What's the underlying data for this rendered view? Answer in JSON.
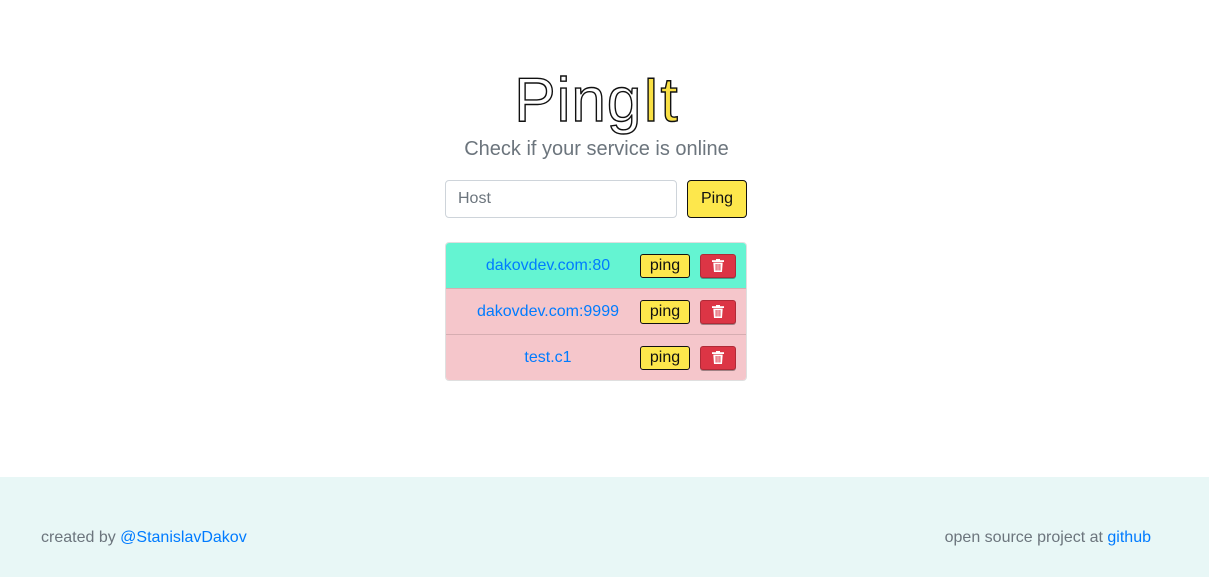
{
  "header": {
    "logo_part1": "Ping",
    "logo_part2": "It",
    "tagline": "Check if your service is online"
  },
  "form": {
    "host_placeholder": "Host",
    "host_value": "",
    "ping_label": "Ping"
  },
  "hosts": [
    {
      "host": "dakovdev.com:80",
      "status": "online",
      "ping_label": "ping",
      "delete_icon": "trash-icon"
    },
    {
      "host": "dakovdev.com:9999",
      "status": "offline",
      "ping_label": "ping",
      "delete_icon": "trash-icon"
    },
    {
      "host": "test.c1",
      "status": "offline",
      "ping_label": "ping",
      "delete_icon": "trash-icon"
    }
  ],
  "footer": {
    "created_prefix": "created by",
    "author_link": "@StanislavDakov",
    "open_source_prefix": "open source project at",
    "github_link": "github"
  },
  "colors": {
    "accent_yellow": "#fde74c",
    "online_row": "#64f4d2",
    "offline_row": "#f5c6cb",
    "delete_red": "#dc3545",
    "link_blue": "#007bff",
    "footer_bg": "#e8f7f6"
  }
}
